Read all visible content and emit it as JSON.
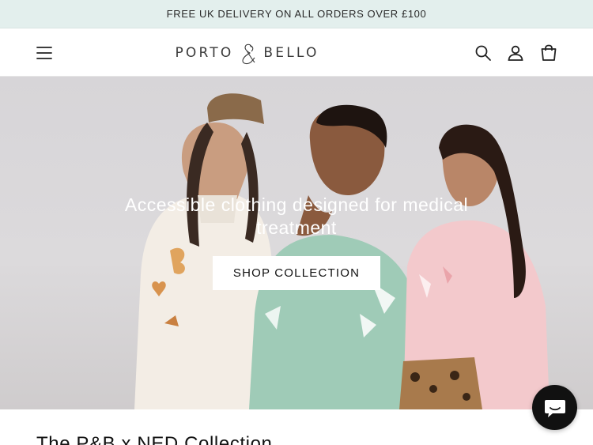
{
  "announcement": {
    "text": "FREE UK DELIVERY ON ALL ORDERS OVER £100"
  },
  "header": {
    "logo_left": "PORTO",
    "logo_right": "BELLO",
    "icons": [
      "menu-icon",
      "search-icon",
      "account-icon",
      "cart-icon"
    ]
  },
  "hero": {
    "title": "Accessible clothing designed for medical treatment",
    "button_label": "SHOP COLLECTION"
  },
  "collection": {
    "title": "The P&B x NED Collection"
  },
  "colors": {
    "announcement_bg": "#e3efed",
    "button_bg": "#ffffff",
    "chat_bg": "#111111",
    "text": "#121212"
  }
}
